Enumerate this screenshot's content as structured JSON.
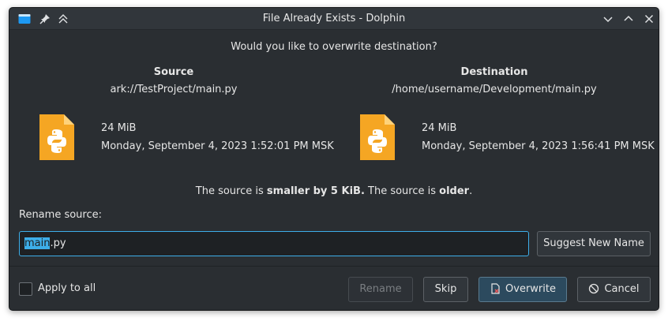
{
  "window": {
    "title": "File Already Exists - Dolphin"
  },
  "dialog": {
    "question": "Would you like to overwrite destination?",
    "source": {
      "heading": "Source",
      "path": "ark://TestProject/main.py",
      "size": "24 MiB",
      "modified": "Monday, September 4, 2023 1:52:01 PM MSK"
    },
    "destination": {
      "heading": "Destination",
      "path": "/home/username/Development/main.py",
      "size": "24 MiB",
      "modified": "Monday, September 4, 2023 1:56:41 PM MSK"
    },
    "comparison": {
      "prefix": "The source is ",
      "size_diff": "smaller by 5 KiB.",
      "middle": " The source is ",
      "age": "older",
      "suffix": "."
    },
    "rename": {
      "label": "Rename source:",
      "value_selected": "main",
      "value_rest": ".py",
      "suggest_label": "Suggest New Name"
    }
  },
  "footer": {
    "apply_all_label": "Apply to all",
    "apply_all_checked": false,
    "rename_label": "Rename",
    "skip_label": "Skip",
    "overwrite_label": "Overwrite",
    "cancel_label": "Cancel"
  },
  "icons": {
    "app": "dolphin-folder-icon",
    "pin": "pin-icon",
    "keep_above": "keep-above-icon",
    "minimize": "chevron-down-icon",
    "maximize": "chevron-up-icon",
    "close": "close-icon",
    "file": "python-file-icon",
    "overwrite": "overwrite-icon",
    "cancel": "cancel-icon"
  },
  "colors": {
    "accent": "#3daee9",
    "file_icon": "#f5a623",
    "window_bg": "#2a2e32"
  }
}
